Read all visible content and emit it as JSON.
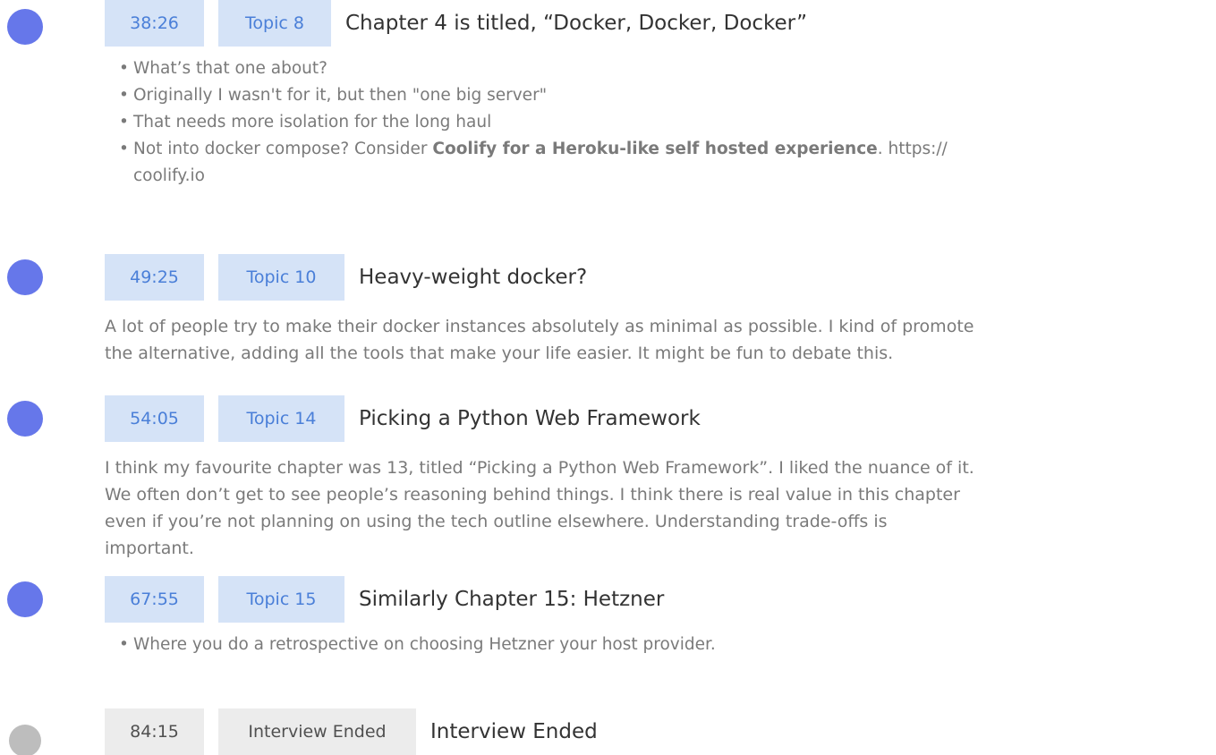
{
  "entries": [
    {
      "time": "38:26",
      "topic": "Topic 8",
      "title": "Chapter 4 is titled, “Docker, Docker, Docker”",
      "bullets": [
        "What’s that one about?",
        "Originally I wasn't for it, but then \"one big server\"",
        "That needs more isolation for the long haul"
      ],
      "bullet4_pre": "Not into docker compose? Consider ",
      "bullet4_bold": "Coolify for a Heroku-like self hosted experience",
      "bullet4_post": ". https://",
      "bullet4_line2": "coolify.io"
    },
    {
      "time": "49:25",
      "topic": "Topic 10",
      "title": "Heavy-weight docker?",
      "para_lines": [
        "A lot of people try to make their docker instances absolutely as minimal as possible. I kind of promote",
        "the alternative, adding all the tools that make your life easier. It might be fun to debate this."
      ]
    },
    {
      "time": "54:05",
      "topic": "Topic 14",
      "title": "Picking a Python Web Framework",
      "para_lines": [
        "I think my favourite chapter was 13, titled “Picking a Python Web Framework”. I liked the nuance of it.",
        "We often don’t get to see people’s reasoning behind things. I think there is real value in this chapter",
        "even if you’re not planning on using the tech outline elsewhere. Understanding trade-offs is",
        "important."
      ]
    },
    {
      "time": "67:55",
      "topic": "Topic 15",
      "title": "Similarly Chapter 15: Hetzner",
      "bullets": [
        "Where you do a retrospective on choosing Hetzner your host provider."
      ]
    },
    {
      "time": "84:15",
      "topic": "Interview Ended",
      "title": "Interview Ended"
    }
  ],
  "colors": {
    "accent_dot": "#6677ea",
    "chip_bg": "#d5e3f7",
    "chip_text": "#4a7fd8",
    "ended_dot": "#bdbdbd",
    "ended_chip_bg": "#ececec"
  }
}
